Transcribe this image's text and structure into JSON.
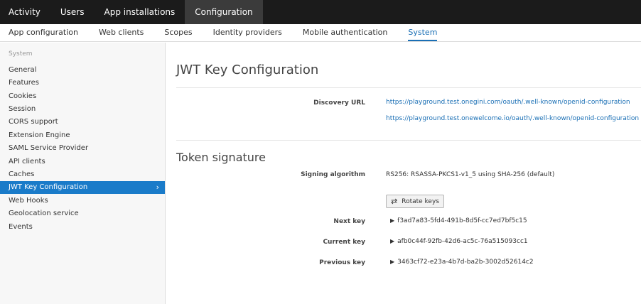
{
  "topnav": {
    "tabs": [
      "Activity",
      "Users",
      "App installations",
      "Configuration"
    ],
    "active": "Configuration"
  },
  "subnav": {
    "items": [
      "App configuration",
      "Web clients",
      "Scopes",
      "Identity providers",
      "Mobile authentication",
      "System"
    ],
    "active": "System"
  },
  "sidebar": {
    "heading": "System",
    "items": [
      "General",
      "Features",
      "Cookies",
      "Session",
      "CORS support",
      "Extension Engine",
      "SAML Service Provider",
      "API clients",
      "Caches",
      "JWT Key Configuration",
      "Web Hooks",
      "Geolocation service",
      "Events"
    ],
    "active": "JWT Key Configuration",
    "chevron": "›"
  },
  "main": {
    "title": "JWT Key Configuration",
    "discovery": {
      "label": "Discovery URL",
      "urls": [
        "https://playground.test.onegini.com/oauth/.well-known/openid-configuration",
        "https://playground.test.onewelcome.io/oauth/.well-known/openid-configuration"
      ]
    },
    "token": {
      "title": "Token signature",
      "signing_label": "Signing algorithm",
      "signing_value": "RS256: RSASSA-PKCS1-v1_5 using SHA-256 (default)",
      "rotate_icon": "⇄",
      "rotate_label": "Rotate keys",
      "expand_icon": "▶",
      "keys": [
        {
          "label": "Next key",
          "value": "f3ad7a83-5fd4-491b-8d5f-cc7ed7bf5c15"
        },
        {
          "label": "Current key",
          "value": "afb0c44f-92fb-42d6-ac5c-76a515093cc1"
        },
        {
          "label": "Previous key",
          "value": "3463cf72-e23a-4b7d-ba2b-3002d52614c2"
        }
      ]
    }
  },
  "colors": {
    "accent": "#1a7bc9",
    "link": "#1a6fb5",
    "topbar": "#1b1b1b"
  }
}
